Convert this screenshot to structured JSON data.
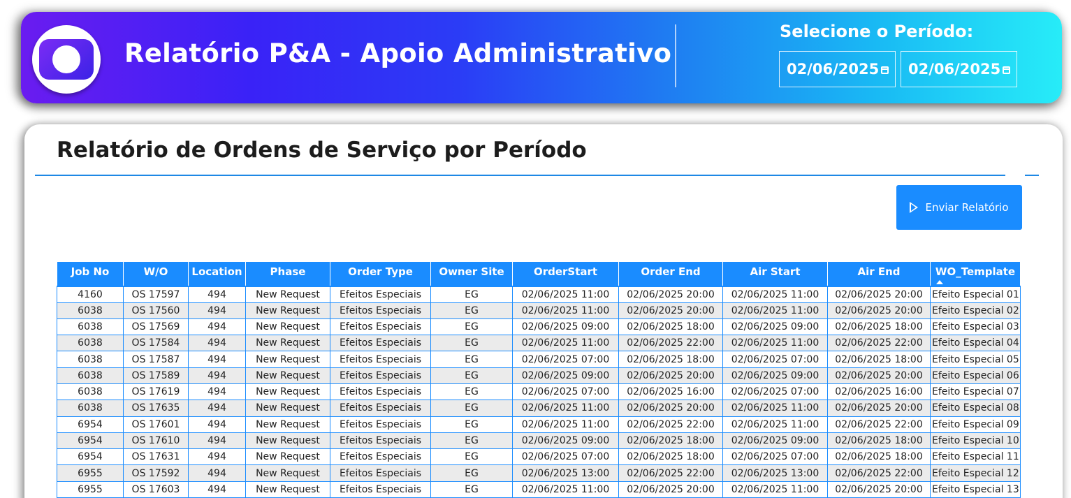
{
  "header": {
    "title": "Relatório P&A - Apoio Administrativo",
    "period_label": "Selecione o Período:",
    "date_start": "02/06/2025",
    "date_end": "02/06/2025",
    "colors": {
      "gradient_start": "#6a1cf0",
      "gradient_end": "#27ecf8"
    }
  },
  "main": {
    "title": "Relatório de Ordens de Serviço por Período",
    "send_button_label": "Enviar Relatório",
    "accent": "#1a8cff"
  },
  "table": {
    "columns": [
      "Job No",
      "W/O",
      "Location",
      "Phase",
      "Order Type",
      "Owner Site",
      "OrderStart",
      "Order End",
      "Air Start",
      "Air End",
      "WO_Template"
    ],
    "sorted_column": "WO_Template",
    "rows": [
      [
        "4160",
        "OS 17597",
        "494",
        "New Request",
        "Efeitos Especiais",
        "EG",
        "02/06/2025 11:00",
        "02/06/2025 20:00",
        "02/06/2025 11:00",
        "02/06/2025 20:00",
        "Efeito Especial 01"
      ],
      [
        "6038",
        "OS 17560",
        "494",
        "New Request",
        "Efeitos Especiais",
        "EG",
        "02/06/2025 11:00",
        "02/06/2025 20:00",
        "02/06/2025 11:00",
        "02/06/2025 20:00",
        "Efeito Especial 02"
      ],
      [
        "6038",
        "OS 17569",
        "494",
        "New Request",
        "Efeitos Especiais",
        "EG",
        "02/06/2025 09:00",
        "02/06/2025 18:00",
        "02/06/2025 09:00",
        "02/06/2025 18:00",
        "Efeito Especial 03"
      ],
      [
        "6038",
        "OS 17584",
        "494",
        "New Request",
        "Efeitos Especiais",
        "EG",
        "02/06/2025 11:00",
        "02/06/2025 22:00",
        "02/06/2025 11:00",
        "02/06/2025 22:00",
        "Efeito Especial 04"
      ],
      [
        "6038",
        "OS 17587",
        "494",
        "New Request",
        "Efeitos Especiais",
        "EG",
        "02/06/2025 07:00",
        "02/06/2025 18:00",
        "02/06/2025 07:00",
        "02/06/2025 18:00",
        "Efeito Especial 05"
      ],
      [
        "6038",
        "OS 17589",
        "494",
        "New Request",
        "Efeitos Especiais",
        "EG",
        "02/06/2025 09:00",
        "02/06/2025 20:00",
        "02/06/2025 09:00",
        "02/06/2025 20:00",
        "Efeito Especial 06"
      ],
      [
        "6038",
        "OS 17619",
        "494",
        "New Request",
        "Efeitos Especiais",
        "EG",
        "02/06/2025 07:00",
        "02/06/2025 16:00",
        "02/06/2025 07:00",
        "02/06/2025 16:00",
        "Efeito Especial 07"
      ],
      [
        "6038",
        "OS 17635",
        "494",
        "New Request",
        "Efeitos Especiais",
        "EG",
        "02/06/2025 11:00",
        "02/06/2025 20:00",
        "02/06/2025 11:00",
        "02/06/2025 20:00",
        "Efeito Especial 08"
      ],
      [
        "6954",
        "OS 17601",
        "494",
        "New Request",
        "Efeitos Especiais",
        "EG",
        "02/06/2025 11:00",
        "02/06/2025 22:00",
        "02/06/2025 11:00",
        "02/06/2025 22:00",
        "Efeito Especial 09"
      ],
      [
        "6954",
        "OS 17610",
        "494",
        "New Request",
        "Efeitos Especiais",
        "EG",
        "02/06/2025 09:00",
        "02/06/2025 18:00",
        "02/06/2025 09:00",
        "02/06/2025 18:00",
        "Efeito Especial 10"
      ],
      [
        "6954",
        "OS 17631",
        "494",
        "New Request",
        "Efeitos Especiais",
        "EG",
        "02/06/2025 07:00",
        "02/06/2025 18:00",
        "02/06/2025 07:00",
        "02/06/2025 18:00",
        "Efeito Especial 11"
      ],
      [
        "6955",
        "OS 17592",
        "494",
        "New Request",
        "Efeitos Especiais",
        "EG",
        "02/06/2025 13:00",
        "02/06/2025 22:00",
        "02/06/2025 13:00",
        "02/06/2025 22:00",
        "Efeito Especial 12"
      ],
      [
        "6955",
        "OS 17603",
        "494",
        "New Request",
        "Efeitos Especiais",
        "EG",
        "02/06/2025 11:00",
        "02/06/2025 20:00",
        "02/06/2025 11:00",
        "02/06/2025 20:00",
        "Efeito Especial 13"
      ]
    ]
  }
}
